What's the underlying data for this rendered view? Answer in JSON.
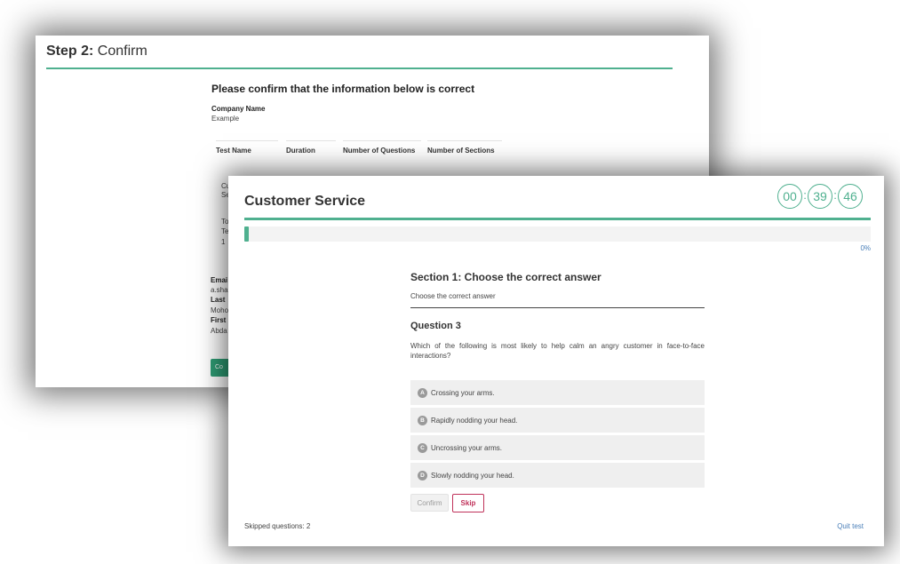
{
  "confirm_window": {
    "step_label": "Step 2:",
    "step_title": "Confirm",
    "heading": "Please confirm that the information below is correct",
    "company_label": "Company Name",
    "company_value": "Example",
    "table_headers": [
      "Test Name",
      "Duration",
      "Number of Questions",
      "Number of Sections"
    ],
    "partial_cells": [
      "Cu",
      "Se",
      "To",
      "Te",
      "1"
    ],
    "partial_fields": {
      "email_label": "Emai",
      "email_value": "a.sha",
      "last_label": "Last",
      "last_value": "Moho",
      "first_label": "First",
      "first_value": "Abda"
    },
    "partial_button": "Co"
  },
  "test_window": {
    "title": "Customer Service",
    "timer": {
      "hours": "00",
      "minutes": "39",
      "seconds": "46"
    },
    "progress": {
      "percent": 0,
      "label": "0%"
    },
    "section_title": "Section 1: Choose the correct answer",
    "section_instruction": "Choose the correct answer",
    "question_title": "Question 3",
    "question_text": "Which of the following is most likely to help calm an angry customer in face-to-face interactions?",
    "options": [
      {
        "letter": "A",
        "text": "Crossing your arms."
      },
      {
        "letter": "B",
        "text": "Rapidly nodding your head."
      },
      {
        "letter": "C",
        "text": "Uncrossing your arms."
      },
      {
        "letter": "D",
        "text": "Slowly nodding your head."
      }
    ],
    "confirm_label": "Confirm",
    "skip_label": "Skip",
    "skipped_text": "Skipped questions: 2",
    "quit_label": "Quit test"
  },
  "colors": {
    "accent": "#4fb08f",
    "skip": "#c0325a",
    "link": "#4a7fb8"
  }
}
